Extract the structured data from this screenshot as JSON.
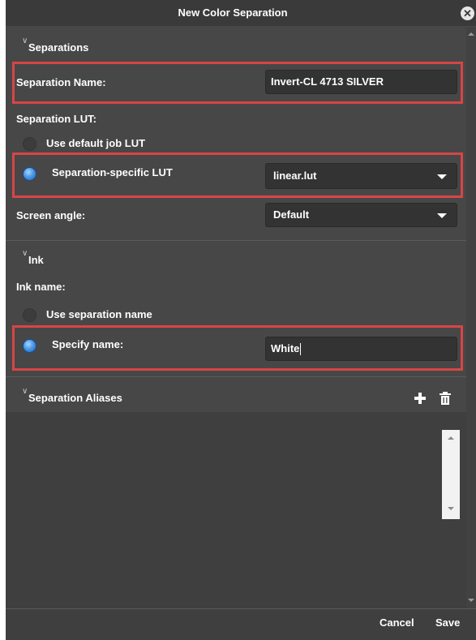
{
  "dialog": {
    "title": "New Color Separation",
    "close_icon": "close-icon"
  },
  "separations": {
    "header": "Separations",
    "separation_name_label": "Separation Name:",
    "separation_name_value": "Invert-CL 4713 SILVER",
    "separation_lut_label": "Separation LUT:",
    "lut_options": {
      "default": "Use default job LUT",
      "specific": "Separation-specific LUT",
      "selected": "specific"
    },
    "lut_select_value": "linear.lut",
    "screen_angle_label": "Screen angle:",
    "screen_angle_value": "Default"
  },
  "ink": {
    "header": "Ink",
    "ink_name_label": "Ink name:",
    "options": {
      "use_separation": "Use separation name",
      "specify": "Specify name:",
      "selected": "specify"
    },
    "ink_name_value": "White"
  },
  "aliases": {
    "header": "Separation Aliases",
    "add_icon": "plus-icon",
    "delete_icon": "trash-icon",
    "items": []
  },
  "footer": {
    "cancel": "Cancel",
    "save": "Save"
  },
  "colors": {
    "panel": "#474747",
    "titlebar": "#3a3a3a",
    "input": "#333333",
    "highlight": "#d84545",
    "radio_on": "#4b9ae8"
  }
}
